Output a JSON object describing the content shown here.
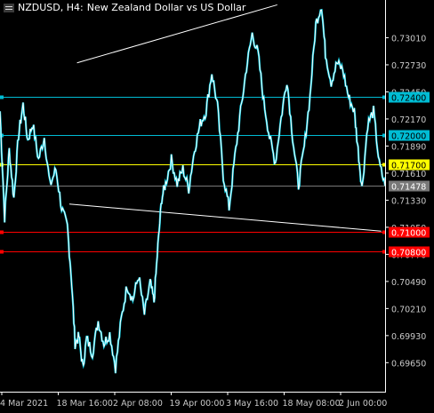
{
  "header": {
    "symbol_timeframe": "NZDUSD, H4:",
    "description": "New Zealand Dollar vs US Dollar"
  },
  "colors": {
    "background": "#000000",
    "candle": "#ffffff",
    "price_line": "#ffffff",
    "wick_down": "#00e5ff",
    "level_cyan": "#00bcd4",
    "level_yellow": "#ffff00",
    "level_red": "#ff0000",
    "current_price": "#787878",
    "axis_text": "#c8c8c8"
  },
  "chart_data": {
    "type": "line",
    "title": "NZDUSD, H4:  New Zealand Dollar vs US Dollar",
    "x_tick_labels": [
      "4 Mar 2021",
      "18 Mar 16:00",
      "2 Apr 08:00",
      "19 Apr 00:00",
      "3 May 16:00",
      "18 May 08:00",
      "2 Jun 00:00"
    ],
    "y_tick_labels": [
      0.7301,
      0.7273,
      0.7245,
      0.7217,
      0.7189,
      0.7161,
      0.7133,
      0.7105,
      0.7077,
      0.7049,
      0.7021,
      0.6993,
      0.6965
    ],
    "ylim": [
      0.6935,
      0.734
    ],
    "horizontal_levels": [
      {
        "name": "level-0.72400",
        "value": 0.724,
        "label": "0.72400",
        "color": "#00bcd4"
      },
      {
        "name": "level-0.72000",
        "value": 0.72,
        "label": "0.72000",
        "color": "#00bcd4"
      },
      {
        "name": "level-0.71700",
        "value": 0.717,
        "label": "0.71700",
        "color": "#ffff00"
      },
      {
        "name": "current-price",
        "value": 0.71478,
        "label": "0.71478",
        "color": "#787878"
      },
      {
        "name": "level-0.71000",
        "value": 0.71,
        "label": "0.71000",
        "color": "#ff0000"
      },
      {
        "name": "level-0.70800",
        "value": 0.708,
        "label": "0.70800",
        "color": "#ff0000"
      }
    ],
    "trendlines": [
      {
        "name": "upper-trendline",
        "points": [
          [
            0.2,
            0.7275
          ],
          [
            0.72,
            0.7335
          ]
        ]
      },
      {
        "name": "lower-trendline",
        "points": [
          [
            0.18,
            0.7129
          ],
          [
            0.99,
            0.7101
          ]
        ]
      }
    ],
    "price_series": [
      [
        0.0,
        0.7225
      ],
      [
        0.012,
        0.7115
      ],
      [
        0.024,
        0.7185
      ],
      [
        0.036,
        0.7135
      ],
      [
        0.048,
        0.72
      ],
      [
        0.06,
        0.7232
      ],
      [
        0.072,
        0.7195
      ],
      [
        0.085,
        0.7212
      ],
      [
        0.1,
        0.7175
      ],
      [
        0.115,
        0.7198
      ],
      [
        0.13,
        0.7148
      ],
      [
        0.145,
        0.7165
      ],
      [
        0.16,
        0.7125
      ],
      [
        0.175,
        0.7105
      ],
      [
        0.185,
        0.7055
      ],
      [
        0.195,
        0.6985
      ],
      [
        0.205,
        0.6992
      ],
      [
        0.215,
        0.696
      ],
      [
        0.225,
        0.699
      ],
      [
        0.24,
        0.6975
      ],
      [
        0.255,
        0.7008
      ],
      [
        0.27,
        0.6985
      ],
      [
        0.285,
        0.6995
      ],
      [
        0.3,
        0.696
      ],
      [
        0.315,
        0.701
      ],
      [
        0.33,
        0.7045
      ],
      [
        0.345,
        0.703
      ],
      [
        0.36,
        0.7055
      ],
      [
        0.375,
        0.7015
      ],
      [
        0.39,
        0.7048
      ],
      [
        0.4,
        0.7028
      ],
      [
        0.41,
        0.7085
      ],
      [
        0.42,
        0.7135
      ],
      [
        0.43,
        0.715
      ],
      [
        0.445,
        0.7175
      ],
      [
        0.46,
        0.715
      ],
      [
        0.475,
        0.7165
      ],
      [
        0.49,
        0.7145
      ],
      [
        0.505,
        0.7185
      ],
      [
        0.52,
        0.7212
      ],
      [
        0.535,
        0.7225
      ],
      [
        0.55,
        0.7265
      ],
      [
        0.565,
        0.723
      ],
      [
        0.58,
        0.7158
      ],
      [
        0.595,
        0.7125
      ],
      [
        0.61,
        0.7178
      ],
      [
        0.625,
        0.7225
      ],
      [
        0.64,
        0.727
      ],
      [
        0.655,
        0.7305
      ],
      [
        0.67,
        0.7285
      ],
      [
        0.685,
        0.7235
      ],
      [
        0.7,
        0.7198
      ],
      [
        0.715,
        0.7172
      ],
      [
        0.73,
        0.7218
      ],
      [
        0.745,
        0.7258
      ],
      [
        0.76,
        0.7198
      ],
      [
        0.775,
        0.7148
      ],
      [
        0.79,
        0.7188
      ],
      [
        0.805,
        0.724
      ],
      [
        0.82,
        0.7315
      ],
      [
        0.835,
        0.7335
      ],
      [
        0.845,
        0.7285
      ],
      [
        0.86,
        0.7255
      ],
      [
        0.875,
        0.7275
      ],
      [
        0.89,
        0.7268
      ],
      [
        0.905,
        0.724
      ],
      [
        0.92,
        0.7225
      ],
      [
        0.93,
        0.7185
      ],
      [
        0.94,
        0.7145
      ],
      [
        0.955,
        0.7212
      ],
      [
        0.97,
        0.7225
      ],
      [
        0.985,
        0.717
      ],
      [
        1.0,
        0.7148
      ]
    ]
  }
}
